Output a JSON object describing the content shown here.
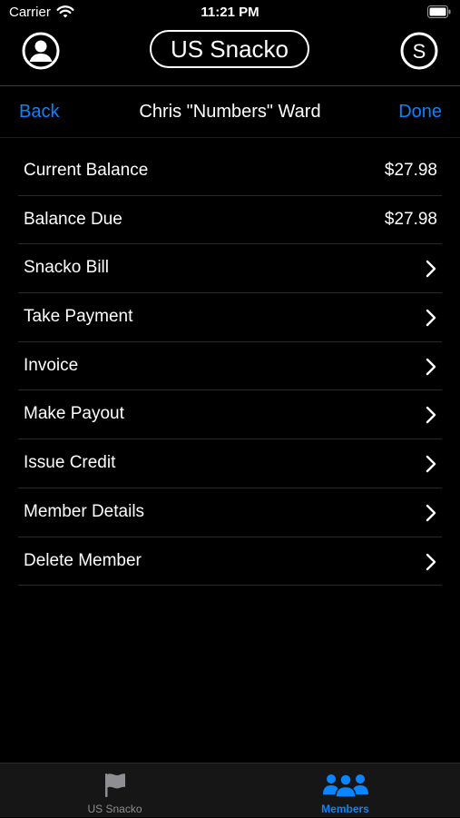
{
  "status_bar": {
    "carrier": "Carrier",
    "time": "11:21 PM"
  },
  "header": {
    "brand": "US Snacko",
    "profile_icon": "person-circle-icon",
    "s_icon": "s-circle-icon"
  },
  "nav": {
    "back": "Back",
    "title": "Chris \"Numbers\" Ward",
    "done": "Done"
  },
  "rows": [
    {
      "label": "Current Balance",
      "value": "$27.98"
    },
    {
      "label": "Balance Due",
      "value": "$27.98"
    },
    {
      "label": "Snacko Bill"
    },
    {
      "label": "Take Payment"
    },
    {
      "label": "Invoice"
    },
    {
      "label": "Make Payout"
    },
    {
      "label": "Issue Credit"
    },
    {
      "label": "Member Details"
    },
    {
      "label": "Delete Member"
    }
  ],
  "tabs": [
    {
      "label": "US Snacko",
      "icon": "flag-icon",
      "active": false
    },
    {
      "label": "Members",
      "icon": "people-icon",
      "active": true
    }
  ],
  "colors": {
    "accent": "#0a84ff",
    "background": "#000000",
    "inactive": "#8e8e93"
  }
}
